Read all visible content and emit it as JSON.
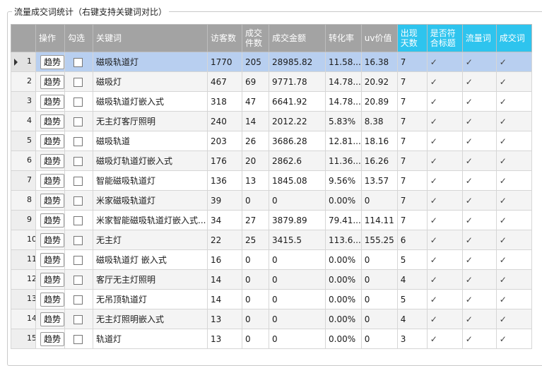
{
  "title": "流量成交词统计（右键支持关键词对比）",
  "colors": {
    "header_gray": "#a3a3a3",
    "header_accent": "#2ec4ee",
    "selected_row": "#b8cff0"
  },
  "table": {
    "columns": {
      "action": "操作",
      "select": "勾选",
      "keyword": "关键词",
      "visitors": "访客数",
      "orders_l1": "成交",
      "orders_l2": "件数",
      "amount": "成交金额",
      "conversion": "转化率",
      "uv_value": "uv价值",
      "days_l1": "出现",
      "days_l2": "天数",
      "in_title_l1": "是否符",
      "in_title_l2": "合标题",
      "traffic_word": "流量词",
      "deal_word": "成交词"
    },
    "trend_label": "趋势",
    "check_mark": "✓",
    "rows": [
      {
        "n": "1",
        "keyword": "磁吸轨道灯",
        "visitors": "1770",
        "orders": "205",
        "amount": "28985.82",
        "conversion": "11.58...",
        "uv": "16.38",
        "days": "7"
      },
      {
        "n": "2",
        "keyword": "磁吸灯",
        "visitors": "467",
        "orders": "69",
        "amount": "9771.78",
        "conversion": "14.78...",
        "uv": "20.92",
        "days": "7"
      },
      {
        "n": "3",
        "keyword": "磁吸轨道灯嵌入式",
        "visitors": "318",
        "orders": "47",
        "amount": "6641.92",
        "conversion": "14.78...",
        "uv": "20.89",
        "days": "7"
      },
      {
        "n": "4",
        "keyword": "无主灯客厅照明",
        "visitors": "240",
        "orders": "14",
        "amount": "2012.22",
        "conversion": "5.83%",
        "uv": "8.38",
        "days": "7"
      },
      {
        "n": "5",
        "keyword": "磁吸轨道",
        "visitors": "203",
        "orders": "26",
        "amount": "3686.28",
        "conversion": "12.81...",
        "uv": "18.16",
        "days": "7"
      },
      {
        "n": "6",
        "keyword": "磁吸灯轨道灯嵌入式",
        "visitors": "176",
        "orders": "20",
        "amount": "2862.6",
        "conversion": "11.36...",
        "uv": "16.26",
        "days": "7"
      },
      {
        "n": "7",
        "keyword": "智能磁吸轨道灯",
        "visitors": "136",
        "orders": "13",
        "amount": "1845.08",
        "conversion": "9.56%",
        "uv": "13.57",
        "days": "7"
      },
      {
        "n": "8",
        "keyword": "米家磁吸轨道灯",
        "visitors": "39",
        "orders": "0",
        "amount": "0",
        "conversion": "0.00%",
        "uv": "0",
        "days": "7"
      },
      {
        "n": "9",
        "keyword": "米家智能磁吸轨道灯嵌入式...",
        "visitors": "34",
        "orders": "27",
        "amount": "3879.89",
        "conversion": "79.41...",
        "uv": "114.11",
        "days": "7"
      },
      {
        "n": "10",
        "keyword": "无主灯",
        "visitors": "22",
        "orders": "25",
        "amount": "3415.5",
        "conversion": "113.6...",
        "uv": "155.25",
        "days": "6"
      },
      {
        "n": "11",
        "keyword": "磁吸轨道灯 嵌入式",
        "visitors": "16",
        "orders": "0",
        "amount": "0",
        "conversion": "0.00%",
        "uv": "0",
        "days": "5"
      },
      {
        "n": "12",
        "keyword": "客厅无主灯照明",
        "visitors": "14",
        "orders": "0",
        "amount": "0",
        "conversion": "0.00%",
        "uv": "0",
        "days": "4"
      },
      {
        "n": "13",
        "keyword": "无吊顶轨道灯",
        "visitors": "14",
        "orders": "0",
        "amount": "0",
        "conversion": "0.00%",
        "uv": "0",
        "days": "5"
      },
      {
        "n": "14",
        "keyword": "无主灯照明嵌入式",
        "visitors": "13",
        "orders": "0",
        "amount": "0",
        "conversion": "0.00%",
        "uv": "0",
        "days": "4"
      },
      {
        "n": "15",
        "keyword": "轨道灯",
        "visitors": "13",
        "orders": "0",
        "amount": "0",
        "conversion": "0.00%",
        "uv": "0",
        "days": "3"
      }
    ]
  }
}
